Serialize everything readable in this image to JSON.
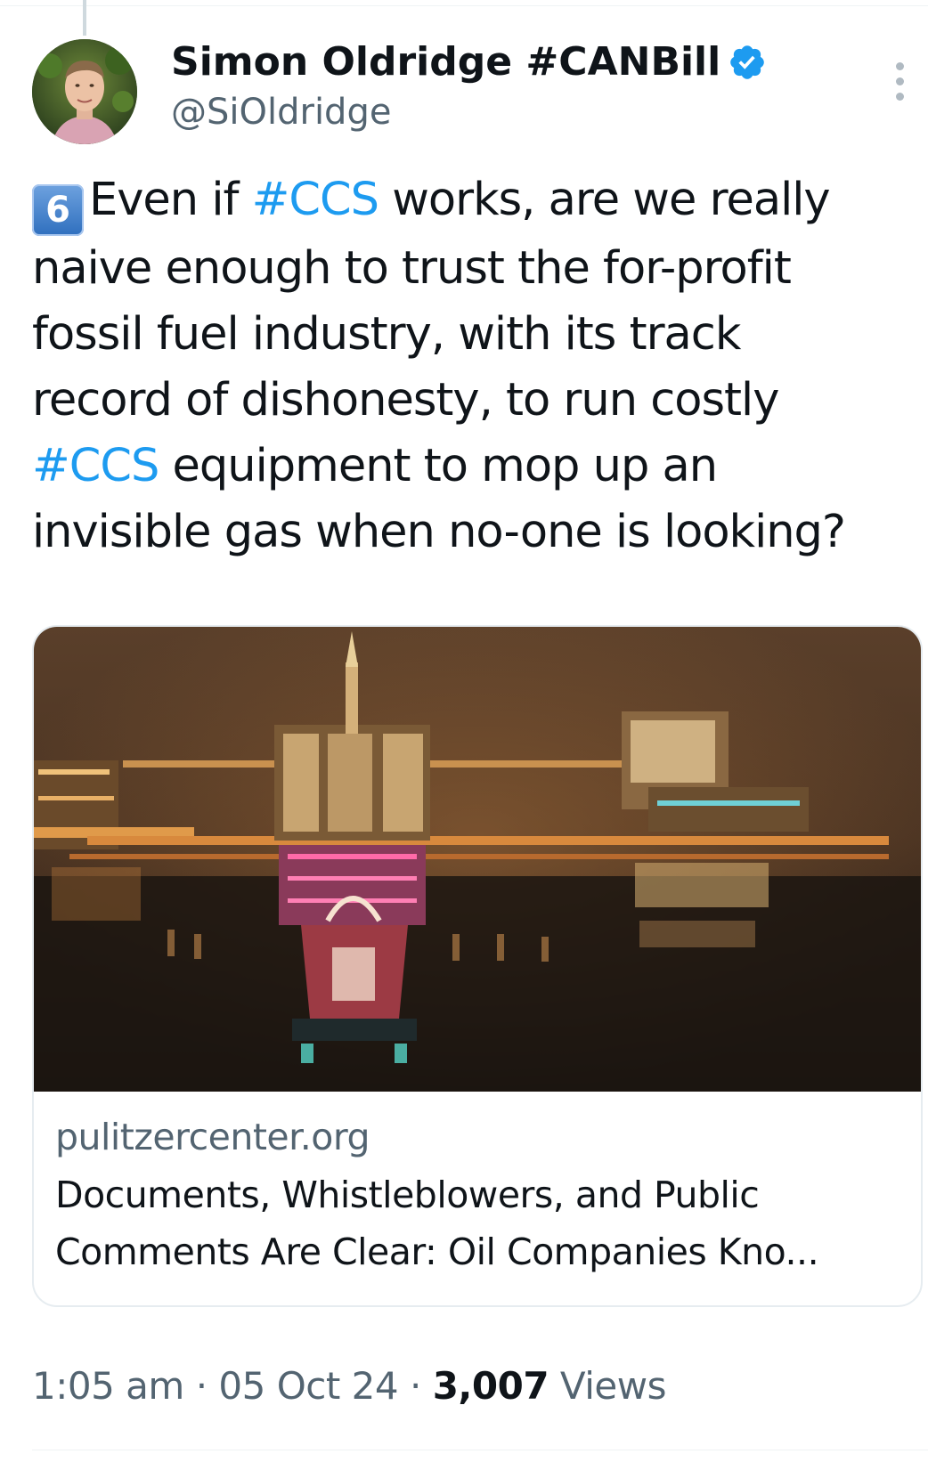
{
  "author": {
    "display_name": "Simon Oldridge #CANBill",
    "handle": "@SiOldridge",
    "verified": true,
    "verified_color": "#1d9bf0"
  },
  "tweet": {
    "keycap": "6",
    "lines": [
      [
        {
          "text": "Even if ",
          "type": "text"
        },
        {
          "text": "#CCS",
          "type": "hashtag"
        },
        {
          "text": " works, are we really",
          "type": "text"
        }
      ],
      [
        {
          "text": "naive enough to trust the for-profit",
          "type": "text"
        }
      ],
      [
        {
          "text": "fossil fuel industry, with its track",
          "type": "text"
        }
      ],
      [
        {
          "text": "record of dishonesty, to run costly",
          "type": "text"
        }
      ],
      [
        {
          "text": "#CCS",
          "type": "hashtag"
        },
        {
          "text": " equipment to mop up an",
          "type": "text"
        }
      ],
      [
        {
          "text": "invisible gas when no-one is looking?",
          "type": "text"
        }
      ]
    ],
    "hashtag_color": "#1d9bf0"
  },
  "card": {
    "domain": "pulitzercenter.org",
    "title_line_1": "Documents, Whistleblowers, and Public",
    "title_line_2": "Comments Are Clear: Oil Companies Kno..."
  },
  "meta": {
    "time": "1:05 am",
    "separator": "·",
    "date": "05 Oct 24",
    "views_count": "3,007",
    "views_label": "Views"
  },
  "icons": {
    "verified": "verified-badge-icon",
    "more": "more-options-icon",
    "keycap": "keycap-digit-six-icon"
  }
}
